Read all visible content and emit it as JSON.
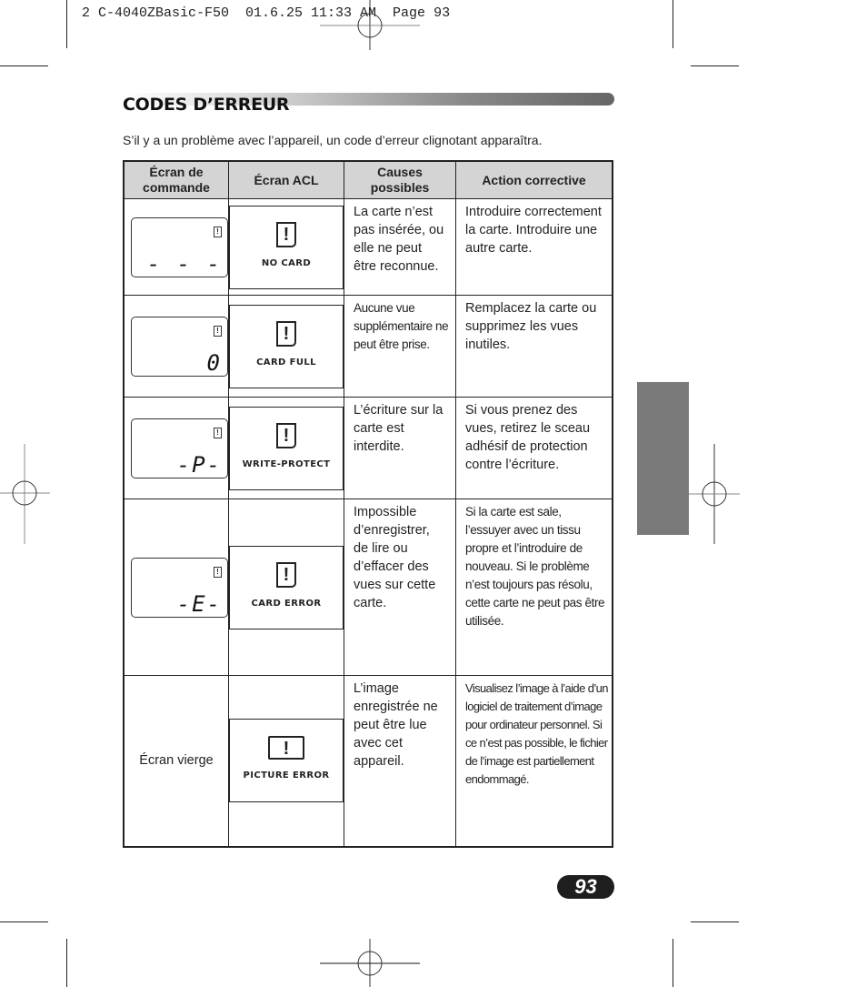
{
  "slug": "2 C-4040ZBasic-F50  01.6.25 11:33 AM  Page 93",
  "section": {
    "title": "CODES D’ERREUR",
    "intro": "S’il y a un problème avec l’appareil, un code d’erreur clignotant apparaîtra."
  },
  "table": {
    "headers": [
      "Écran de commande",
      "Écran ACL",
      "Causes possibles",
      "Action corrective"
    ],
    "rows": [
      {
        "control_display": "- - -",
        "control_icon": "!",
        "lcd_label": "NO  CARD",
        "cause": "La carte n’est pas insérée, ou elle ne peut être reconnue.",
        "action": "Introduire correctement la carte. Introduire une autre carte."
      },
      {
        "control_display": "0",
        "control_icon": "!",
        "lcd_label": "CARD  FULL",
        "cause": "Aucune vue supplémentaire ne peut être prise.",
        "action": "Remplacez la carte ou supprimez les vues inutiles."
      },
      {
        "control_display": "-P-",
        "control_icon": "!",
        "lcd_label": "WRITE-PROTECT",
        "cause": "L’écriture sur la carte est interdite.",
        "action": "Si vous prenez des vues, retirez le sceau adhésif de protection contre l’écriture."
      },
      {
        "control_display": "-E-",
        "control_icon": "!",
        "lcd_label": "CARD  ERROR",
        "cause": "Impossible d’enregistrer, de lire ou d’effacer des vues sur cette carte.",
        "action": "Si la carte est sale, l’essuyer avec un tissu propre et l’introduire de nouveau. Si le problème n’est toujours pas résolu, cette carte ne peut pas être utilisée."
      },
      {
        "control_display_text": "Écran vierge",
        "lcd_label": "PICTURE  ERROR",
        "cause": "L’image enregistrée ne peut être lue avec cet appareil.",
        "action": "Visualisez l’image à l’aide d’un logiciel de traitement d’image pour ordinateur personnel. Si ce n’est pas possible, le fichier de l’image est partiellement endommagé."
      }
    ]
  },
  "lcd_icon_glyph": "!",
  "page_number": "93"
}
